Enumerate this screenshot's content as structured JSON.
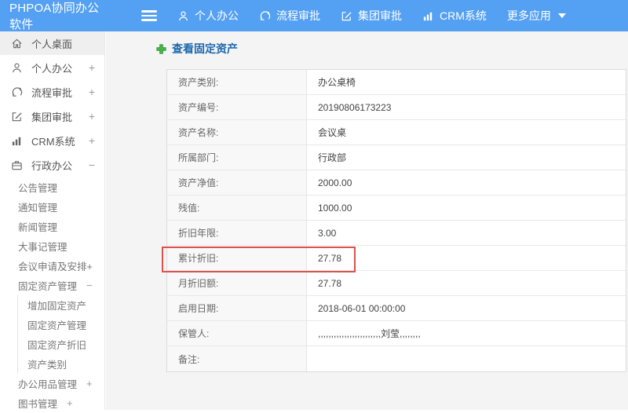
{
  "header": {
    "logo": "PHPOA协同办公软件",
    "nav": [
      {
        "label": "个人办公",
        "icon": "person-icon"
      },
      {
        "label": "流程审批",
        "icon": "process-icon"
      },
      {
        "label": "集团审批",
        "icon": "edit-icon"
      },
      {
        "label": "CRM系统",
        "icon": "bar-chart-icon"
      },
      {
        "label": "更多应用",
        "icon": "caret-down-icon"
      }
    ]
  },
  "sidebar": {
    "items": [
      {
        "label": "个人桌面",
        "icon": "home-icon",
        "level": 1,
        "active": true
      },
      {
        "label": "个人办公",
        "icon": "person-icon",
        "level": 1,
        "expander": "+"
      },
      {
        "label": "流程审批",
        "icon": "process-icon",
        "level": 1,
        "expander": "+"
      },
      {
        "label": "集团审批",
        "icon": "edit-icon",
        "level": 1,
        "expander": "+"
      },
      {
        "label": "CRM系统",
        "icon": "bar-chart-icon",
        "level": 1,
        "expander": "+"
      },
      {
        "label": "行政办公",
        "icon": "briefcase-icon",
        "level": 1,
        "expander": "−"
      },
      {
        "label": "公告管理",
        "level": 2
      },
      {
        "label": "通知管理",
        "level": 2
      },
      {
        "label": "新闻管理",
        "level": 2
      },
      {
        "label": "大事记管理",
        "level": 2
      },
      {
        "label": "会议申请及安排+",
        "level": 2
      },
      {
        "label": "固定资产管理",
        "level": 2,
        "expander": "−"
      },
      {
        "label": "增加固定资产",
        "level": 3
      },
      {
        "label": "固定资产管理",
        "level": 3
      },
      {
        "label": "固定资产折旧",
        "level": 3
      },
      {
        "label": "资产类别",
        "level": 3
      },
      {
        "label": "办公用品管理",
        "level": 2,
        "expander": "+"
      },
      {
        "label": "图书管理",
        "level": 2,
        "expander": "+"
      }
    ]
  },
  "main": {
    "title": "查看固定资产",
    "title_icon": "green-plus-icon",
    "table": {
      "rows": [
        {
          "label": "资产类别:",
          "value": "办公桌椅"
        },
        {
          "label": "资产编号:",
          "value": "20190806173223"
        },
        {
          "label": "资产名称:",
          "value": "会议桌"
        },
        {
          "label": "所属部门:",
          "value": "行政部"
        },
        {
          "label": "资产净值:",
          "value": "2000.00"
        },
        {
          "label": "残值:",
          "value": "1000.00"
        },
        {
          "label": "折旧年限:",
          "value": "3.00"
        },
        {
          "label": "累计折旧:",
          "value": "27.78"
        },
        {
          "label": "月折旧额:",
          "value": "27.78"
        },
        {
          "label": "启用日期:",
          "value": "2018-06-01 00:00:00"
        },
        {
          "label": "保管人:",
          "value": ",,,,,,,,,,,,,,,,,,,,,,,,刘莹,,,,,,,,"
        },
        {
          "label": "备注:",
          "value": ""
        }
      ],
      "highlighted_row_label": "累计折旧:"
    }
  },
  "colors": {
    "header_blue": "#54a0f2",
    "title_blue": "#1b67ad",
    "highlight_red": "#d9534f",
    "green_plus": "#44b549"
  }
}
